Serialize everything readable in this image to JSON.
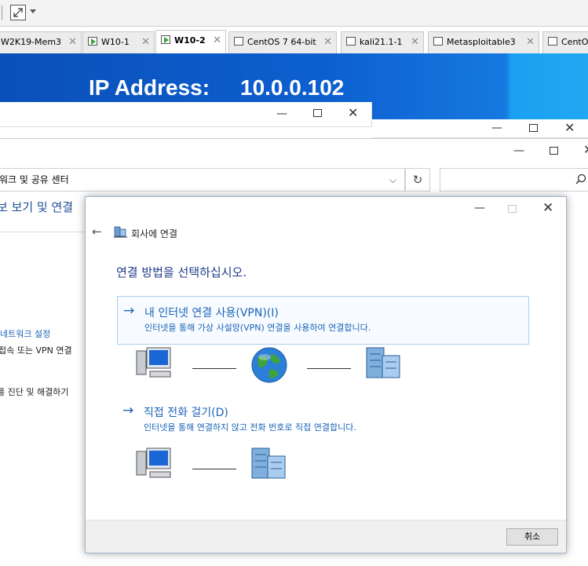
{
  "vm": {
    "tabs": [
      {
        "label": "W2K19-Mem3",
        "active": false,
        "icon": "none"
      },
      {
        "label": "W10-1",
        "active": false,
        "icon": "vm-running-icon"
      },
      {
        "label": "W10-2",
        "active": true,
        "icon": "vm-running-icon"
      },
      {
        "label": "CentOS 7 64-bit",
        "active": false,
        "icon": "vm-icon"
      },
      {
        "label": "kali21.1-1",
        "active": false,
        "icon": "vm-icon"
      },
      {
        "label": "Metasploitable3",
        "active": false,
        "icon": "vm-icon"
      },
      {
        "label": "CentOS",
        "active": false,
        "icon": "vm-icon"
      }
    ],
    "close_glyph": "✕"
  },
  "banner": {
    "label": "IP Address:",
    "value": "10.0.0.102"
  },
  "explorer": {
    "address": "워크 및 공유 센터",
    "title": "보 보기 및 연결",
    "link1": "네트워크 설정",
    "text1": "접속 또는 VPN 연결",
    "text2": "를 진단 및 해결하기"
  },
  "dialog": {
    "title": "회사에 연결",
    "heading": "연결 방법을 선택하십시오.",
    "options": [
      {
        "title": "내 인터넷 연결 사용(VPN)(I)",
        "desc": "인터넷을 통해 가상 사설망(VPN) 연결을 사용하여 연결합니다."
      },
      {
        "title": "직접 전화 걸기(D)",
        "desc": "인터넷을 통해 연결하지 않고 전화 번호로 직접 연결합니다."
      }
    ],
    "cancel_label": "취소"
  },
  "colors": {
    "banner_blue": "#0d5fd0",
    "link_blue": "#1a64b8",
    "heading_blue": "#1e3a8a"
  }
}
